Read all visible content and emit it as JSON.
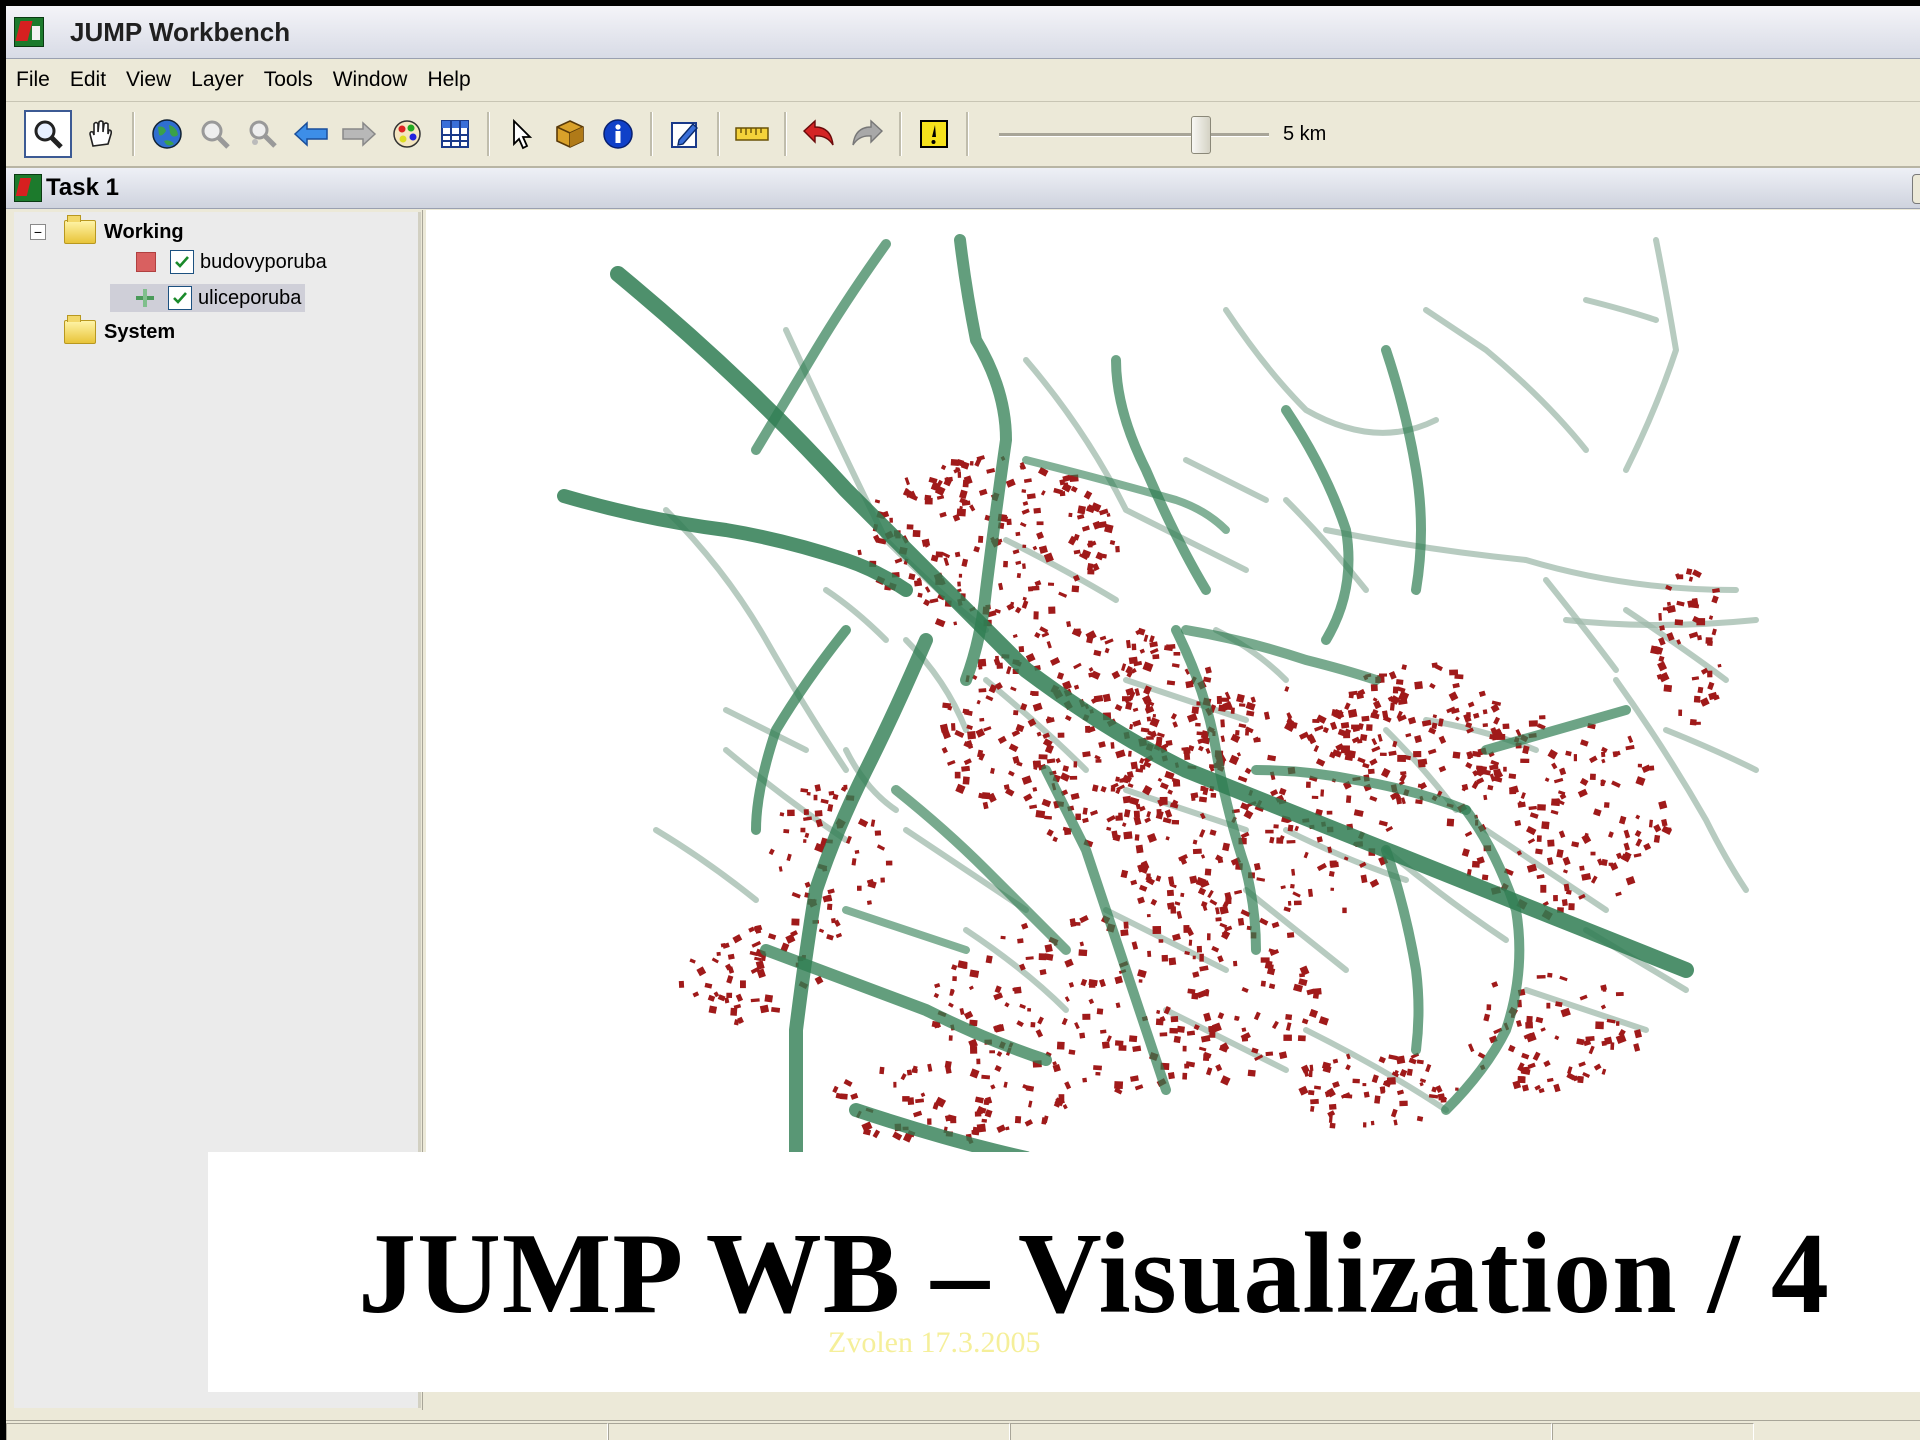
{
  "window": {
    "title": "JUMP Workbench"
  },
  "menu": {
    "items": [
      "File",
      "Edit",
      "View",
      "Layer",
      "Tools",
      "Window",
      "Help"
    ]
  },
  "toolbar": {
    "tools": [
      "zoom-tool",
      "pan-tool",
      "zoom-full-extent",
      "zoom-to-selection",
      "zoom-previous",
      "zoom-back",
      "zoom-forward",
      "layer-colors",
      "attribute-table",
      "select-tool",
      "feature-info-tool",
      "info-tool",
      "edit-tool",
      "measure-tool",
      "undo",
      "redo",
      "warning"
    ],
    "scale_label": "5 km",
    "scale_slider_fraction": 0.72
  },
  "task": {
    "title": "Task 1"
  },
  "layer_tree": {
    "categories": [
      {
        "name": "Working",
        "expanded": true,
        "layers": [
          {
            "name": "budovyporuba",
            "visible": true,
            "style": "polygon",
            "color": "#d96060",
            "selected": false
          },
          {
            "name": "uliceporuba",
            "visible": true,
            "style": "line",
            "color": "#4a9a5a",
            "selected": true
          }
        ]
      },
      {
        "name": "System",
        "expanded": false,
        "layers": []
      }
    ]
  },
  "map": {
    "description_colors": {
      "streets": "#2f7d52",
      "minor_streets": "#9fb9ab",
      "buildings": "#a01a1a"
    }
  },
  "slide": {
    "title": "JUMP WB – Visualization / 4",
    "subtitle": "Zvolen 17.3.2005"
  }
}
